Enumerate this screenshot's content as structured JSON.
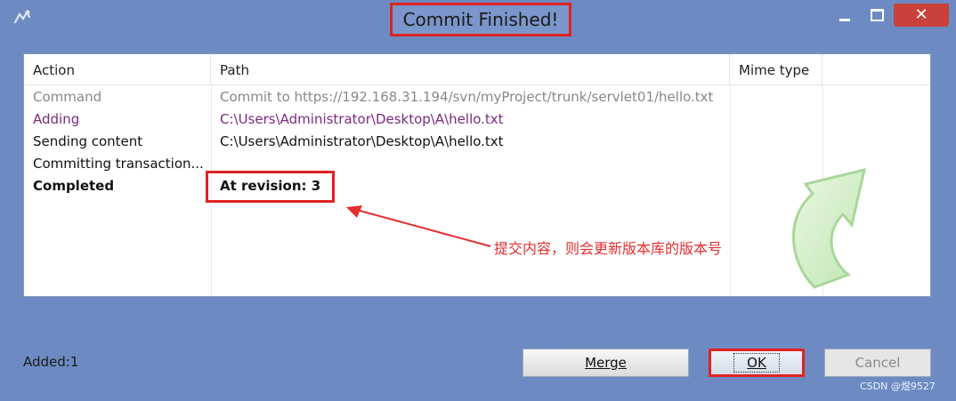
{
  "window": {
    "title": "Commit Finished!",
    "icon": "tortoise-icon"
  },
  "list": {
    "columns": [
      "Action",
      "Path",
      "Mime type"
    ],
    "rows": [
      {
        "action": "Command",
        "path": "Commit to https://192.168.31.194/svn/myProject/trunk/servlet01/hello.txt",
        "color": "#888888"
      },
      {
        "action": "Adding",
        "path": "C:\\Users\\Administrator\\Desktop\\A\\hello.txt",
        "color": "#7b2a80"
      },
      {
        "action": "Sending content",
        "path": "C:\\Users\\Administrator\\Desktop\\A\\hello.txt",
        "color": "#111111"
      },
      {
        "action": "Committing transaction...",
        "path": "",
        "color": "#111111"
      },
      {
        "action": "Completed",
        "path": "At revision: 3",
        "color": "#111111"
      }
    ]
  },
  "annotation": {
    "text": "提交内容，则会更新版本库的版本号",
    "color": "#e03030"
  },
  "footer": {
    "status": "Added:1",
    "merge_label": "Merge",
    "ok_label": "OK",
    "cancel_label": "Cancel"
  },
  "watermark": "CSDN @煜9527"
}
